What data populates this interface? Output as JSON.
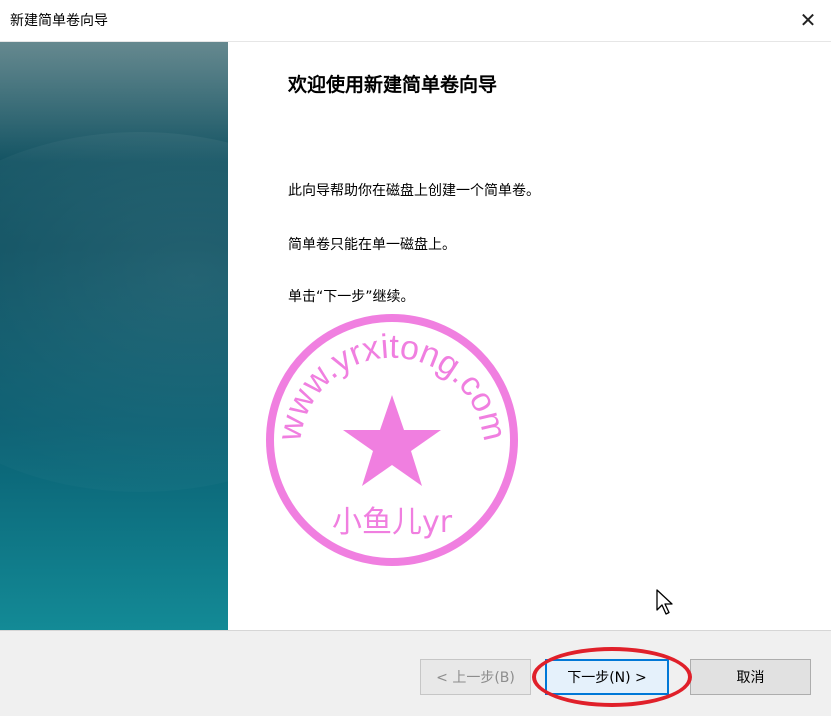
{
  "window": {
    "title": "新建简单卷向导",
    "close_glyph": "✕"
  },
  "content": {
    "heading": "欢迎使用新建简单卷向导",
    "line1": "此向导帮助你在磁盘上创建一个简单卷。",
    "line2": "简单卷只能在单一磁盘上。",
    "line3": "单击“下一步”继续。"
  },
  "watermark": {
    "text_arc": "www.yrxitong.com",
    "text_bottom": "小鱼儿yr",
    "color": "#f07fe0"
  },
  "buttons": {
    "back": "< 上一步(B)",
    "next": "下一步(N) >",
    "cancel": "取消"
  },
  "colors": {
    "banner_dark": "#0b4f60",
    "banner_light": "#138a96",
    "focus_border": "#0078d7",
    "highlight_ring": "#e0202a"
  }
}
